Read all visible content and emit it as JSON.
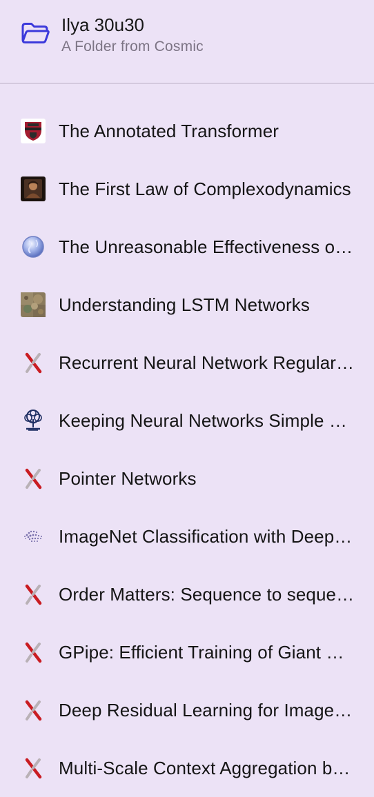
{
  "header": {
    "title": "Ilya 30u30",
    "subtitle": "A Folder from Cosmic",
    "icon": "folder-icon",
    "accent_color": "#3b39db"
  },
  "items": [
    {
      "label": "The Annotated Transformer",
      "icon": "harvard-shield-favicon-icon"
    },
    {
      "label": "The First Law of Complexodynamics",
      "icon": "portrait-favicon-icon"
    },
    {
      "label": "The Unreasonable Effectiveness of Recurrent Neural Networks",
      "icon": "globe-icon"
    },
    {
      "label": "Understanding LSTM Networks",
      "icon": "textured-image-favicon-icon"
    },
    {
      "label": "Recurrent Neural Network Regularization",
      "icon": "arxiv-x-icon"
    },
    {
      "label": "Keeping Neural Networks Simple by Minimizing the Description Length of the Weights",
      "icon": "tree-logo-icon"
    },
    {
      "label": "Pointer Networks",
      "icon": "arxiv-x-icon"
    },
    {
      "label": "ImageNet Classification with Deep Convolutional Neural Networks",
      "icon": "dotted-logo-icon"
    },
    {
      "label": "Order Matters: Sequence to sequence for sets",
      "icon": "arxiv-x-icon"
    },
    {
      "label": "GPipe: Efficient Training of Giant Neural Networks using Pipeline Parallelism",
      "icon": "arxiv-x-icon"
    },
    {
      "label": "Deep Residual Learning for Image Recognition",
      "icon": "arxiv-x-icon"
    },
    {
      "label": "Multi-Scale Context Aggregation by Dilated Convolutions",
      "icon": "arxiv-x-icon"
    }
  ]
}
